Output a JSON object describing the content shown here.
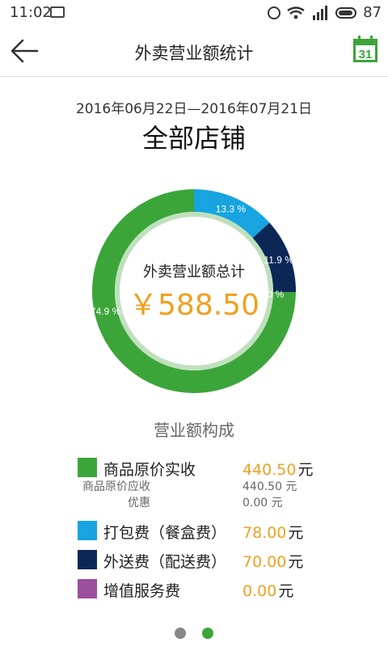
{
  "status_bar": {
    "time": "11:02",
    "battery": "87"
  },
  "app_bar": {
    "title": "外卖营业额统计",
    "calendar_day": "31"
  },
  "date_range": "2016年06月22日—2016年07月21日",
  "store": "全部店铺",
  "summary": {
    "label": "外卖营业额总计",
    "value": "￥588.50"
  },
  "chart_data": {
    "type": "pie",
    "labels": [
      "商品原价实收",
      "打包费（餐盒费）",
      "外送费（配送费）",
      "增值服务费"
    ],
    "values": [
      74.9,
      13.3,
      11.9,
      0.0
    ],
    "value_labels": [
      "74.9 %",
      "13.3 %",
      "11.9 %",
      "0.0 %"
    ],
    "colors": [
      "#3ca53a",
      "#17a4e0",
      "#0b2756",
      "#9b4f9c"
    ]
  },
  "legend": {
    "title": "营业额构成",
    "unit": "元",
    "items": [
      {
        "label": "商品原价实收",
        "value": "440.50",
        "color": "#3ca53a"
      },
      {
        "label": "打包费（餐盒费）",
        "value": "78.00",
        "color": "#17a4e0"
      },
      {
        "label": "外送费（配送费）",
        "value": "70.00",
        "color": "#0b2756"
      },
      {
        "label": "增值服务费",
        "value": "0.00",
        "color": "#9b4f9c"
      }
    ],
    "details": [
      {
        "label": "商品原价应收",
        "value": "440.50 元"
      },
      {
        "label": "优惠",
        "value": "0.00 元"
      }
    ]
  },
  "pager": {
    "count": 2,
    "active": 1,
    "active_color": "#3ca53a",
    "inactive_color": "#888888"
  }
}
